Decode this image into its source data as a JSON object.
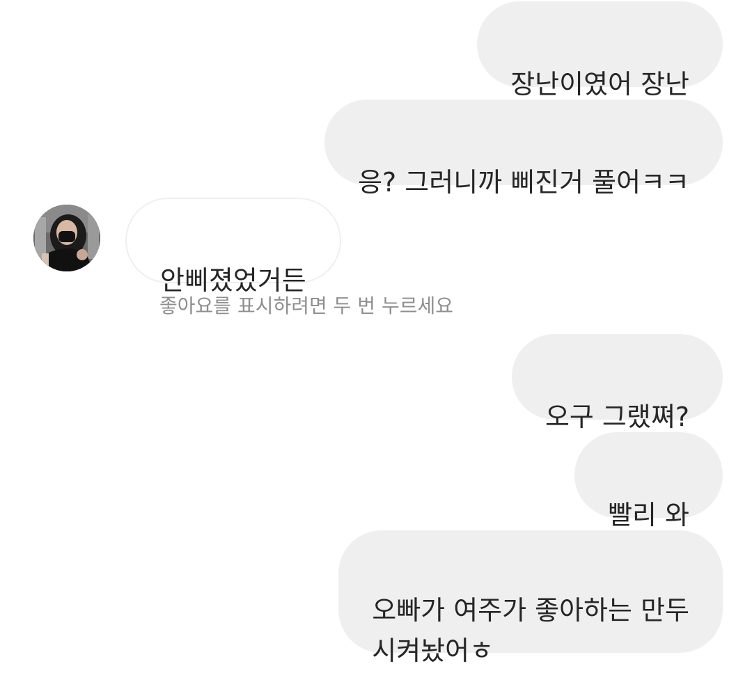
{
  "conversation": {
    "messages": [
      {
        "id": 1,
        "direction": "sent",
        "text": "장난이였어 장난"
      },
      {
        "id": 2,
        "direction": "sent",
        "text": "응? 그러니까 삐진거 풀어ㅋㅋ"
      },
      {
        "id": 3,
        "direction": "received",
        "text": "안삐졌었거든"
      },
      {
        "id": 4,
        "direction": "sent",
        "text": "오구 그랬쪄?"
      },
      {
        "id": 5,
        "direction": "sent",
        "text": "빨리 와"
      },
      {
        "id": 6,
        "direction": "sent",
        "text": "오빠가 여주가 좋아하는 만두\n시켜놨어ㅎ"
      }
    ],
    "like_hint": "좋아요를 표시하려면 두 번 누르세요"
  },
  "contact": {
    "avatar_icon": "profile-photo-avatar"
  },
  "colors": {
    "sent_bubble": "#efefef",
    "received_border": "#efefef",
    "text": "#262626",
    "hint_text": "#8e8e8e"
  }
}
